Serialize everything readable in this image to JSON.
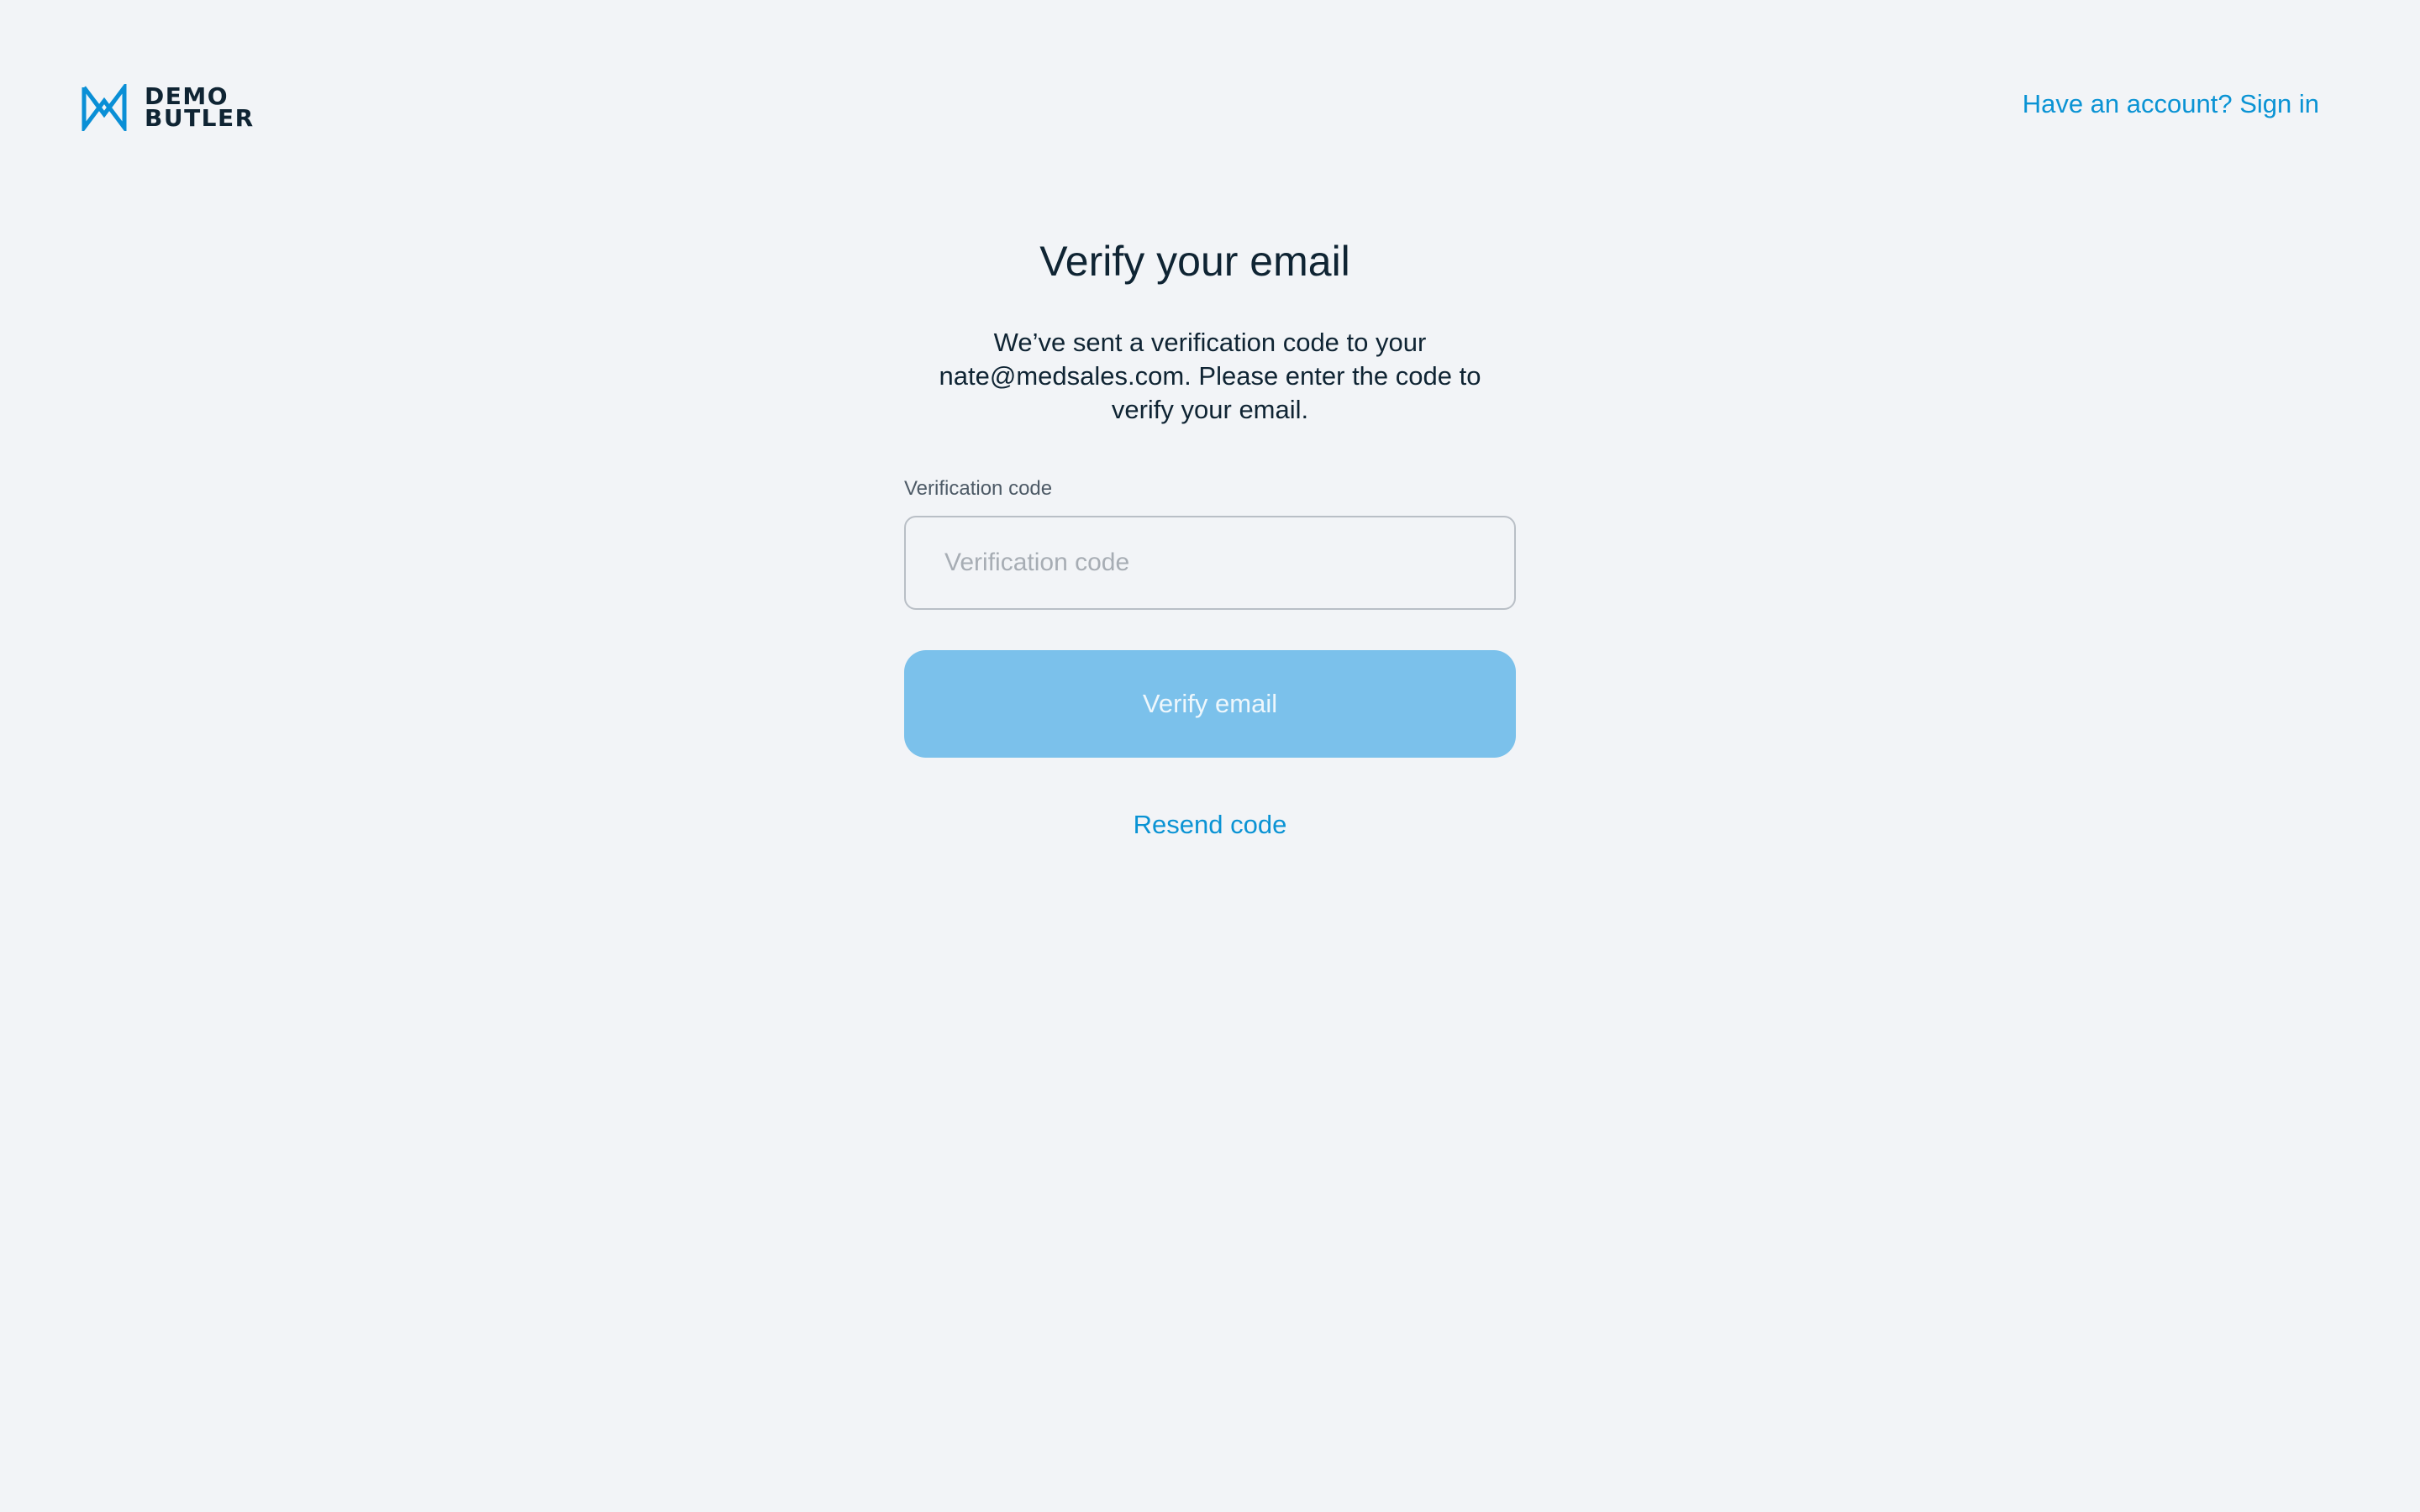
{
  "brand": {
    "line1": "DEMO",
    "line2": "BUTLER",
    "logo_icon": "demo-butler-logo-icon",
    "accent_color": "#0a93d4"
  },
  "header": {
    "signin_link": "Have an account? Sign in"
  },
  "main": {
    "title": "Verify your email",
    "description": "We’ve sent a verification code to your nate@medsales.com. Please enter the code to verify your email.",
    "field_label": "Verification code",
    "field_placeholder": "Verification code",
    "field_value": "",
    "verify_button": "Verify email",
    "verify_button_color": "#7bc1eb",
    "resend_link": "Resend code"
  }
}
